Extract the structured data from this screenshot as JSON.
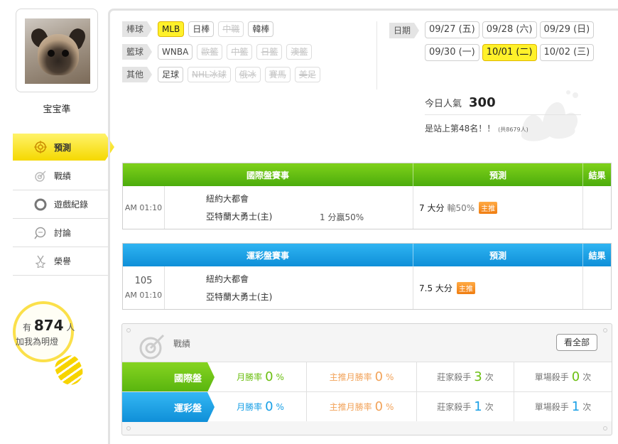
{
  "user": {
    "name": "宝宝準"
  },
  "nav": [
    {
      "label": "預測",
      "icon": "target-icon",
      "active": true
    },
    {
      "label": "戰績",
      "icon": "record-icon",
      "active": false
    },
    {
      "label": "遊戲紀錄",
      "icon": "circle-icon",
      "active": false
    },
    {
      "label": "討論",
      "icon": "chat-icon",
      "active": false
    },
    {
      "label": "榮譽",
      "icon": "medal-icon",
      "active": false
    }
  ],
  "fans": {
    "prefix": "有",
    "count": "874",
    "unit": "人",
    "line2": "加我為明燈"
  },
  "filters": {
    "baseball": {
      "label": "棒球",
      "tags": [
        "MLB",
        "日棒",
        "中職",
        "韓棒"
      ]
    },
    "basketball": {
      "label": "籃球",
      "tags": [
        "WNBA",
        "歐籃",
        "中籃",
        "日籃",
        "澳籃"
      ]
    },
    "other": {
      "label": "其他",
      "tags": [
        "足球",
        "NHL冰球",
        "俄冰",
        "賽馬",
        "美足"
      ]
    }
  },
  "dates": {
    "label": "日期",
    "items": [
      "09/27 (五)",
      "09/28 (六)",
      "09/29 (日)",
      "09/30 (一)",
      "10/01 (二)",
      "10/02 (三)"
    ],
    "selected": "10/01 (二)"
  },
  "popularity": {
    "label": "今日人氣",
    "value": "300",
    "rank_text": "是站上第48名！！",
    "total_text": "(共8679人)"
  },
  "intl_table": {
    "headers": [
      "國際盤賽事",
      "預測",
      "結果"
    ],
    "row": {
      "time": "AM 01:10",
      "team1": "紐約大都會",
      "team2": "亞特蘭大勇士(主)",
      "odds": "1 分贏50%",
      "prediction": "7 大分",
      "pct": "輸50%",
      "badge": "主推",
      "result": ""
    }
  },
  "lottery_table": {
    "headers": [
      "運彩盤賽事",
      "預測",
      "結果"
    ],
    "row": {
      "code": "105",
      "time": "AM 01:10",
      "team1": "紐約大都會",
      "team2": "亞特蘭大勇士(主)",
      "prediction": "7.5 大分",
      "badge": "主推",
      "result": ""
    }
  },
  "record": {
    "title": "戰績",
    "view_all": "看全部",
    "rows": [
      {
        "name": "國際盤",
        "monthly_label": "月勝率",
        "monthly": "0",
        "monthly_unit": "%",
        "main_label": "主推月勝率",
        "main": "0",
        "main_unit": "%",
        "killer_label": "莊家殺手",
        "killer": "3",
        "killer_unit": "次",
        "single_label": "單場殺手",
        "single": "0",
        "single_unit": "次"
      },
      {
        "name": "運彩盤",
        "monthly_label": "月勝率",
        "monthly": "0",
        "monthly_unit": "%",
        "main_label": "主推月勝率",
        "main": "0",
        "main_unit": "%",
        "killer_label": "莊家殺手",
        "killer": "1",
        "killer_unit": "次",
        "single_label": "單場殺手",
        "single": "1",
        "single_unit": "次"
      }
    ]
  }
}
